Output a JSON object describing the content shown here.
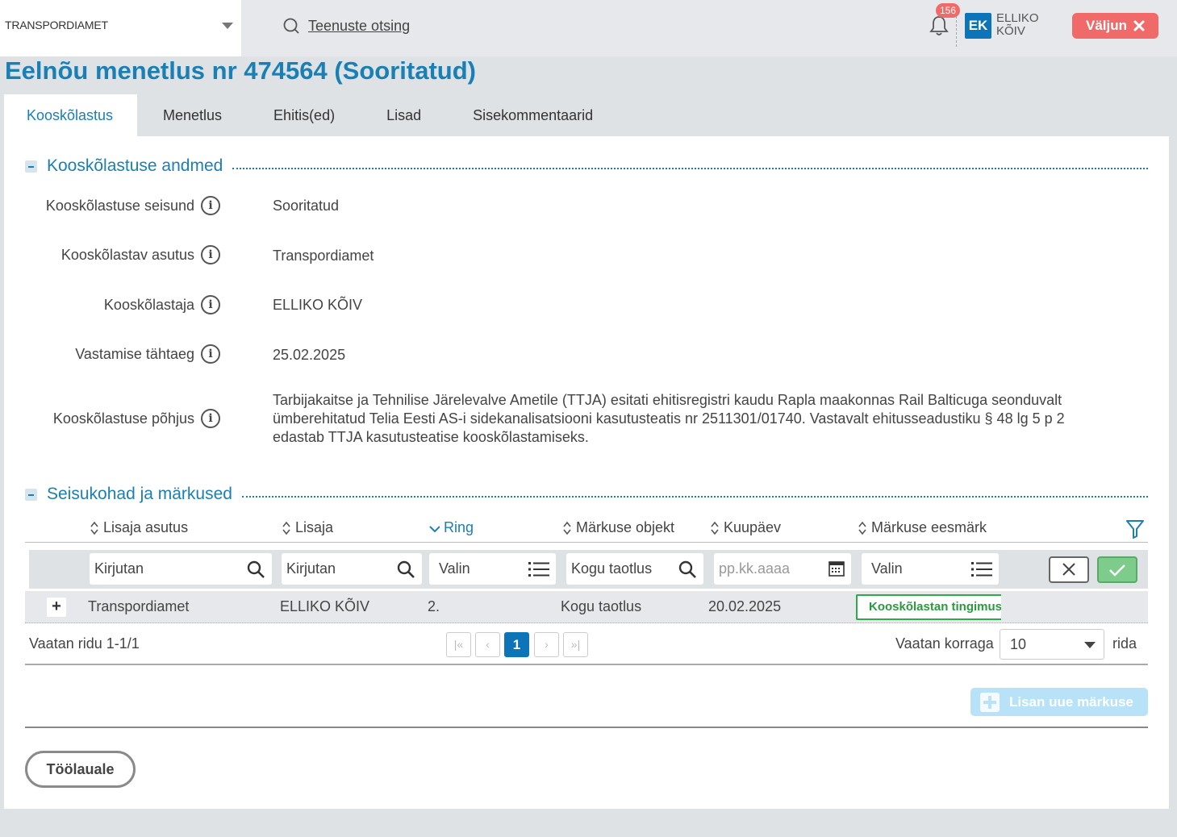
{
  "header": {
    "org": "TRANSPORDIAMET",
    "search_link": "Teenuste otsing",
    "notifications_count": "156",
    "avatar_initials": "EK",
    "user_first": "ELLIKO",
    "user_last": "KÕIV",
    "logout_label": "Väljun"
  },
  "page": {
    "title": "Eelnõu menetlus nr 474564 (Sooritatud)"
  },
  "tabs": [
    {
      "label": "Kooskõlastus",
      "active": true
    },
    {
      "label": "Menetlus"
    },
    {
      "label": "Ehitis(ed)"
    },
    {
      "label": "Lisad"
    },
    {
      "label": "Sisekommentaarid"
    }
  ],
  "section1": {
    "title": "Kooskõlastuse andmed",
    "fields": [
      {
        "label": "Kooskõlastuse seisund",
        "value": "Sooritatud"
      },
      {
        "label": "Kooskõlastav asutus",
        "value": "Transpordiamet"
      },
      {
        "label": "Kooskõlastaja",
        "value": "ELLIKO KÕIV"
      },
      {
        "label": "Vastamise tähtaeg",
        "value": "25.02.2025"
      },
      {
        "label": "Kooskõlastuse põhjus",
        "value": "Tarbijakaitse ja Tehnilise Järelevalve Ametile (TTJA) esitati ehitisregistri kaudu Rapla maakonnas Rail Balticuga seonduvalt ümberehitatud Telia Eesti AS-i sidekanalisatsiooni kasutusteatis nr 2511301/01740. Vastavalt ehitusseadustiku § 48 lg 5 p 2 edastab TTJA kasutusteatise kooskõlastamiseks."
      }
    ],
    "info_glyph": "i"
  },
  "section2": {
    "title": "Seisukohad ja märkused",
    "columns": [
      "Lisaja asutus",
      "Lisaja",
      "Ring",
      "Märkuse objekt",
      "Kuupäev",
      "Märkuse eesmärk"
    ],
    "filters": {
      "asutus": "Kirjutan",
      "lisaja": "Kirjutan",
      "ring": "Valin",
      "objekt": "Kogu taotlus",
      "kuupaev": "pp.kk.aaaa",
      "eesmark": "Valin"
    },
    "rows": [
      {
        "expand": "+",
        "asutus": "Transpordiamet",
        "lisaja": "ELLIKO KÕIV",
        "ring": "2.",
        "objekt": "Kogu taotlus",
        "kuupaev": "20.02.2025",
        "eesmark": "Kooskõlastan tingimustega"
      }
    ],
    "pager": {
      "info": "Vaatan ridu 1-1/1",
      "first": "|«",
      "prev": "‹",
      "current": "1",
      "next": "›",
      "last": "»|",
      "per_page_label": "Vaatan korraga",
      "per_page": "10",
      "rows_suffix": "rida"
    },
    "add_note_label": "Lisan uue märkuse"
  },
  "footer": {
    "back_label": "Töölauale"
  },
  "colors": {
    "accent": "#1a7fb5",
    "danger": "#f06a6a",
    "success": "#2eaa4a",
    "primary": "#0e74b8"
  }
}
